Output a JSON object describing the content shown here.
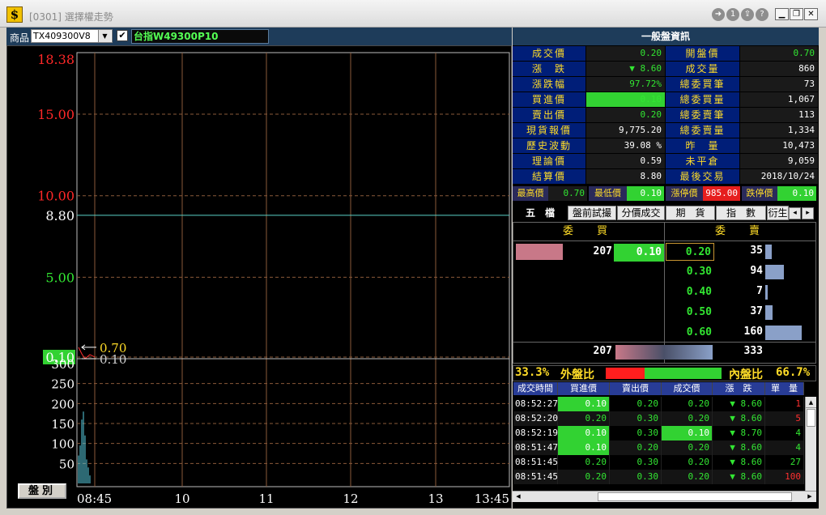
{
  "window": {
    "title": "[0301] 選擇權走勢",
    "logo_letter": "$",
    "title_icons": [
      "forward-icon",
      "info-icon",
      "export-icon",
      "help-icon"
    ],
    "title_icon_glyphs": [
      "➜",
      "1",
      "⇪",
      "?"
    ]
  },
  "toolbar": {
    "product_label": "商品",
    "product_code": "TX409300V8",
    "checkbox_checked": "✔",
    "product_name": "台指W49300P10"
  },
  "chart": {
    "price_ticks": [
      "18.38",
      "15.00",
      "10.00",
      "8.80",
      "5.00",
      "0.10"
    ],
    "volume_ticks": [
      "300",
      "250",
      "200",
      "150",
      "100",
      "50"
    ],
    "time_ticks": [
      "08:45",
      "10",
      "11",
      "12",
      "13",
      "13:45"
    ],
    "markers": {
      "current": "0.70",
      "reference": "0.10"
    },
    "button_label": "盤別",
    "colors": {
      "up": "#ff2828",
      "flat": "#ffffff",
      "down": "#32e632",
      "prev_close_line": "#5ad2c8",
      "grid": "#8a5a3a"
    }
  },
  "chart_data": {
    "type": "line",
    "price_range": [
      0,
      18.38
    ],
    "prev_close": 8.8,
    "last_price": 0.7,
    "low_price": 0.1,
    "volume_range": [
      0,
      300
    ],
    "volume_bars": [
      70,
      95,
      160,
      180,
      120,
      60,
      40,
      20
    ]
  },
  "info": {
    "header": "一般盤資訊",
    "rows": [
      {
        "l1": "成交價",
        "v1": "0.20",
        "l2": "開盤價",
        "v2": "0.70"
      },
      {
        "l1": "漲　跌",
        "v1": "▼ 8.60",
        "l2": "成交量",
        "v2": "860"
      },
      {
        "l1": "漲跌幅",
        "v1": "97.72%",
        "l2": "總委買筆",
        "v2": "73"
      },
      {
        "l1": "買進價",
        "v1": "0.10",
        "l2": "總委買量",
        "v2": "1,067"
      },
      {
        "l1": "賣出價",
        "v1": "0.20",
        "l2": "總委賣筆",
        "v2": "113"
      },
      {
        "l1": "現貨報價",
        "v1": "9,775.20",
        "l2": "總委賣量",
        "v2": "1,334"
      },
      {
        "l1": "歷史波動",
        "v1": "39.08 %",
        "l2": "昨　量",
        "v2": "10,473"
      },
      {
        "l1": "理論價",
        "v1": "0.59",
        "l2": "未平倉",
        "v2": "9,059"
      },
      {
        "l1": "結算價",
        "v1": "8.80",
        "l2": "最後交易",
        "v2": "2018/10/24"
      }
    ],
    "bottom": [
      {
        "label": "最高價",
        "value": "0.70"
      },
      {
        "label": "最低價",
        "value": "0.10"
      },
      {
        "label": "漲停價",
        "value": "985.00"
      },
      {
        "label": "跌停價",
        "value": "0.10"
      }
    ]
  },
  "tabs": [
    "五　檔",
    "盤前試撮",
    "分價成交",
    "期　貨",
    "指　數",
    "衍生"
  ],
  "nav": {
    "left": "◂",
    "right": "▸"
  },
  "orderbook": {
    "buy_header": "委　買",
    "sell_header": "委　賣",
    "bids": [
      {
        "qty": "207",
        "price": "0.10",
        "fill": 0.45
      }
    ],
    "asks": [
      {
        "price": "0.20",
        "qty": "35",
        "fill": 0.1
      },
      {
        "price": "0.30",
        "qty": "94",
        "fill": 0.3
      },
      {
        "price": "0.40",
        "qty": "7",
        "fill": 0.02
      },
      {
        "price": "0.50",
        "qty": "37",
        "fill": 0.12
      },
      {
        "price": "0.60",
        "qty": "160",
        "fill": 0.6
      }
    ],
    "total_bid": "207",
    "total_ask": "333"
  },
  "ratio": {
    "out_pct": "33.3%",
    "out_label": "外盤比",
    "in_label": "內盤比",
    "in_pct": "66.7%",
    "out_fraction": 0.333
  },
  "trades": {
    "headers": [
      "成交時間",
      "買進價",
      "賣出價",
      "成交價",
      "漲　跌",
      "單　量"
    ],
    "rows": [
      {
        "time": "08:52:27",
        "bid": "0.10",
        "ask": "0.20",
        "price": "0.20",
        "chg": "▼ 8.60",
        "vol": "1"
      },
      {
        "time": "08:52:20",
        "bid": "0.20",
        "ask": "0.30",
        "price": "0.20",
        "chg": "▼ 8.60",
        "vol": "5"
      },
      {
        "time": "08:52:19",
        "bid": "0.10",
        "ask": "0.30",
        "price": "0.10",
        "chg": "▼ 8.70",
        "vol": "4"
      },
      {
        "time": "08:51:47",
        "bid": "0.10",
        "ask": "0.20",
        "price": "0.20",
        "chg": "▼ 8.60",
        "vol": "4"
      },
      {
        "time": "08:51:45",
        "bid": "0.20",
        "ask": "0.30",
        "price": "0.20",
        "chg": "▼ 8.60",
        "vol": "27"
      },
      {
        "time": "08:51:45",
        "bid": "0.20",
        "ask": "0.30",
        "price": "0.20",
        "chg": "▼ 8.60",
        "vol": "100"
      }
    ]
  }
}
